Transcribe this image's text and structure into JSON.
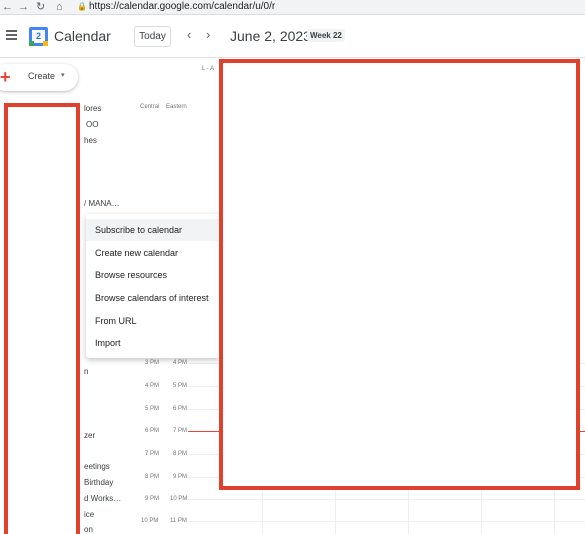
{
  "browser": {
    "url": "https://calendar.google.com/calendar/u/0/r",
    "icons": {
      "back": "arrow-back-icon",
      "forward": "arrow-forward-icon",
      "reload": "reload-icon",
      "home": "home-icon",
      "lock": "lock-icon"
    }
  },
  "header": {
    "app_title": "Calendar",
    "logo_number": "2",
    "today_label": "Today",
    "prev_glyph": "‹",
    "next_glyph": "›",
    "date_title": "June 2, 2023",
    "week_badge": "Week 22"
  },
  "create": {
    "label": "Create",
    "plus": "+",
    "caret": "▾"
  },
  "sidebar_fragments": [
    "lores",
    "OO",
    "hes",
    "/ MANA…",
    "n",
    "zer",
    "eetings",
    "Birthday",
    "d Works…",
    "ice",
    "on"
  ],
  "timezones": {
    "primary": "Central",
    "secondary": "Eastern"
  },
  "column_header": "L - A",
  "times": [
    {
      "central": "3 PM",
      "eastern": "4 PM"
    },
    {
      "central": "4 PM",
      "eastern": "5 PM"
    },
    {
      "central": "5 PM",
      "eastern": "6 PM"
    },
    {
      "central": "6 PM",
      "eastern": "7 PM"
    },
    {
      "central": "7 PM",
      "eastern": "8 PM"
    },
    {
      "central": "8 PM",
      "eastern": "9 PM"
    },
    {
      "central": "9 PM",
      "eastern": "10 PM"
    },
    {
      "central": "10 PM",
      "eastern": "11 PM"
    }
  ],
  "context_menu": {
    "items": [
      "Subscribe to calendar",
      "Create new calendar",
      "Browse resources",
      "Browse calendars of interest",
      "From URL",
      "Import"
    ]
  },
  "colors": {
    "redaction": "#e0412c",
    "now_line": "#ea4335",
    "brand_blue": "#4285f4"
  }
}
